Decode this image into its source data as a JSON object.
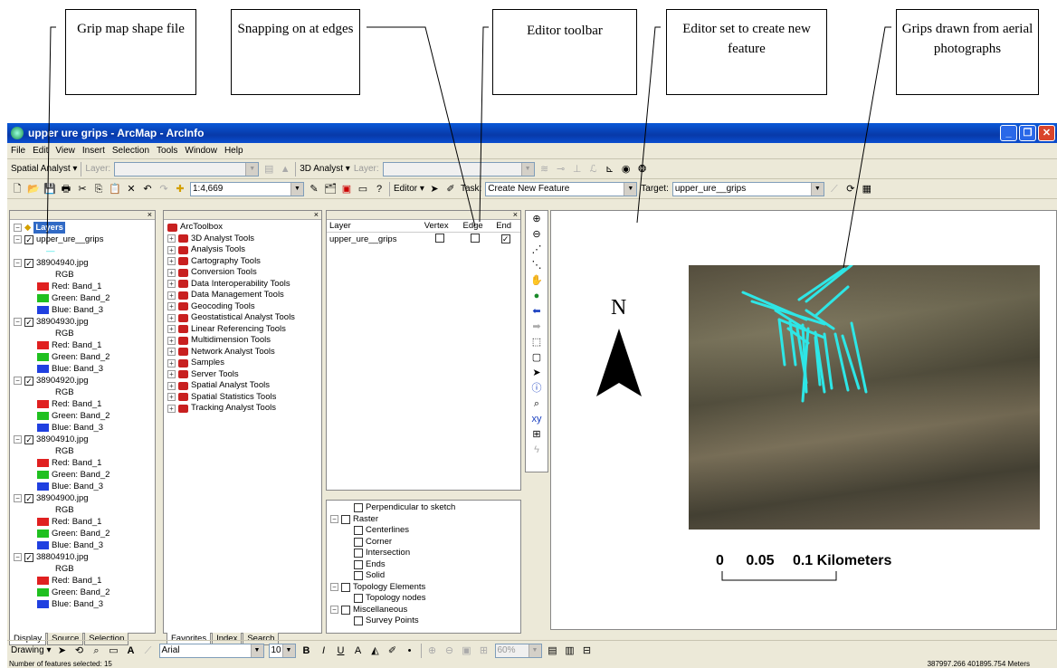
{
  "callouts": [
    {
      "text": "Grip map shape file"
    },
    {
      "text": "Snapping on at edges"
    },
    {
      "text": "Editor toolbar"
    },
    {
      "text": "Editor set to create new feature"
    },
    {
      "text": "Grips drawn from aerial photographs"
    }
  ],
  "window": {
    "title": "upper ure grips - ArcMap - ArcInfo"
  },
  "menu": [
    "File",
    "Edit",
    "View",
    "Insert",
    "Selection",
    "Tools",
    "Window",
    "Help"
  ],
  "toolbar1": {
    "spatial_analyst": "Spatial Analyst",
    "layer_label": "Layer:",
    "analyst_3d": "3D Analyst",
    "layer_label2": "Layer:"
  },
  "toolbar2": {
    "scale": "1:4,669",
    "editor": "Editor",
    "task_label": "Task:",
    "task_value": "Create New Feature",
    "target_label": "Target:",
    "target_value": "upper_ure__grips"
  },
  "toc": {
    "root": "Layers",
    "items": [
      {
        "kind": "layer",
        "label": "upper_ure__grips"
      },
      {
        "kind": "line",
        "label": "—"
      },
      {
        "kind": "layer",
        "label": "38904940.jpg"
      },
      {
        "kind": "rgb",
        "label": "RGB"
      },
      {
        "kind": "band",
        "label": "Red:   Band_1",
        "color": "#e02020"
      },
      {
        "kind": "band",
        "label": "Green: Band_2",
        "color": "#20c020"
      },
      {
        "kind": "band",
        "label": "Blue:  Band_3",
        "color": "#2040e0"
      },
      {
        "kind": "layer",
        "label": "38904930.jpg"
      },
      {
        "kind": "rgb",
        "label": "RGB"
      },
      {
        "kind": "band",
        "label": "Red:   Band_1",
        "color": "#e02020"
      },
      {
        "kind": "band",
        "label": "Green: Band_2",
        "color": "#20c020"
      },
      {
        "kind": "band",
        "label": "Blue:  Band_3",
        "color": "#2040e0"
      },
      {
        "kind": "layer",
        "label": "38904920.jpg"
      },
      {
        "kind": "rgb",
        "label": "RGB"
      },
      {
        "kind": "band",
        "label": "Red:   Band_1",
        "color": "#e02020"
      },
      {
        "kind": "band",
        "label": "Green: Band_2",
        "color": "#20c020"
      },
      {
        "kind": "band",
        "label": "Blue:  Band_3",
        "color": "#2040e0"
      },
      {
        "kind": "layer",
        "label": "38904910.jpg"
      },
      {
        "kind": "rgb",
        "label": "RGB"
      },
      {
        "kind": "band",
        "label": "Red:   Band_1",
        "color": "#e02020"
      },
      {
        "kind": "band",
        "label": "Green: Band_2",
        "color": "#20c020"
      },
      {
        "kind": "band",
        "label": "Blue:  Band_3",
        "color": "#2040e0"
      },
      {
        "kind": "layer",
        "label": "38904900.jpg"
      },
      {
        "kind": "rgb",
        "label": "RGB"
      },
      {
        "kind": "band",
        "label": "Red:   Band_1",
        "color": "#e02020"
      },
      {
        "kind": "band",
        "label": "Green: Band_2",
        "color": "#20c020"
      },
      {
        "kind": "band",
        "label": "Blue:  Band_3",
        "color": "#2040e0"
      },
      {
        "kind": "layer",
        "label": "38804910.jpg"
      },
      {
        "kind": "rgb",
        "label": "RGB"
      },
      {
        "kind": "band",
        "label": "Red:   Band_1",
        "color": "#e02020"
      },
      {
        "kind": "band",
        "label": "Green: Band_2",
        "color": "#20c020"
      },
      {
        "kind": "band",
        "label": "Blue:  Band_3",
        "color": "#2040e0"
      }
    ],
    "tabs": [
      "Display",
      "Source",
      "Selection"
    ]
  },
  "toolbox": {
    "root": "ArcToolbox",
    "items": [
      "3D Analyst Tools",
      "Analysis Tools",
      "Cartography Tools",
      "Conversion Tools",
      "Data Interoperability Tools",
      "Data Management Tools",
      "Geocoding Tools",
      "Geostatistical Analyst Tools",
      "Linear Referencing Tools",
      "Multidimension Tools",
      "Network Analyst Tools",
      "Samples",
      "Server Tools",
      "Spatial Analyst Tools",
      "Spatial Statistics Tools",
      "Tracking Analyst Tools"
    ],
    "tabs": [
      "Favorites",
      "Index",
      "Search"
    ]
  },
  "snapping": {
    "headers": [
      "Layer",
      "Vertex",
      "Edge",
      "End"
    ],
    "row": {
      "layer": "upper_ure__grips",
      "vertex": false,
      "edge": false,
      "end": true
    },
    "tree": [
      {
        "indent": 1,
        "label": "Perpendicular to sketch",
        "pm": ""
      },
      {
        "indent": 0,
        "label": "Raster",
        "pm": "−"
      },
      {
        "indent": 1,
        "label": "Centerlines",
        "pm": ""
      },
      {
        "indent": 1,
        "label": "Corner",
        "pm": ""
      },
      {
        "indent": 1,
        "label": "Intersection",
        "pm": ""
      },
      {
        "indent": 1,
        "label": "Ends",
        "pm": ""
      },
      {
        "indent": 1,
        "label": "Solid",
        "pm": ""
      },
      {
        "indent": 0,
        "label": "Topology Elements",
        "pm": "−"
      },
      {
        "indent": 1,
        "label": "Topology nodes",
        "pm": ""
      },
      {
        "indent": 0,
        "label": "Miscellaneous",
        "pm": "−"
      },
      {
        "indent": 1,
        "label": "Survey Points",
        "pm": ""
      }
    ]
  },
  "map": {
    "north": "N",
    "scale_0": "0",
    "scale_1": "0.05",
    "scale_2": "0.1 Kilometers",
    "grip_color": "#2ee6e6"
  },
  "drawing": {
    "label": "Drawing",
    "font": "Arial",
    "size": "10",
    "zoom": "60%"
  },
  "status": {
    "text": "Number of features selected: 15",
    "coords": "387997.266  401895.754 Meters"
  }
}
